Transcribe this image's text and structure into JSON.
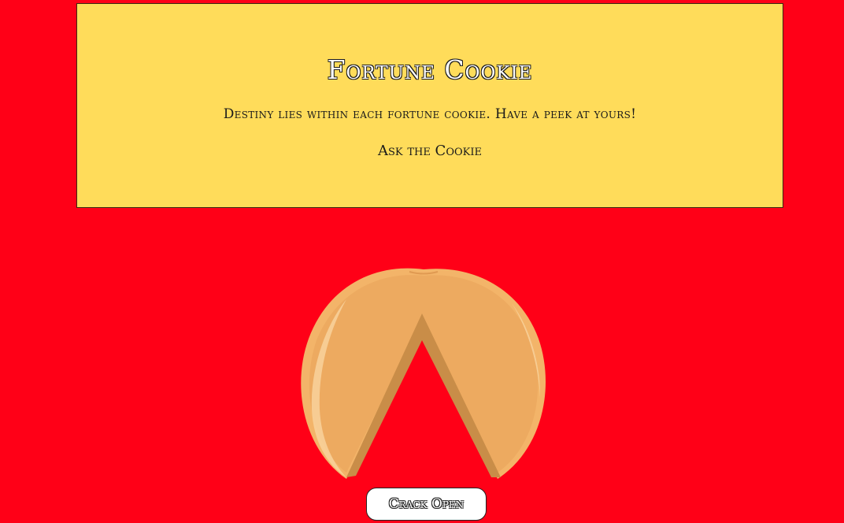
{
  "header": {
    "title": "Fortune Cookie",
    "tagline": "Destiny lies within each fortune cookie. Have a peek at yours!",
    "ask_link": "Ask the Cookie"
  },
  "cookie": {
    "icon": "fortune-cookie-icon",
    "colors": {
      "body": "#edaa60",
      "edge": "#f3b469",
      "shadow": "#c98d48",
      "highlight": "#f8d29c"
    }
  },
  "actions": {
    "crack_open_label": "Crack Open"
  },
  "colors": {
    "background": "#ff0017",
    "card": "#ffdc5a",
    "text": "#1a1a1a"
  }
}
